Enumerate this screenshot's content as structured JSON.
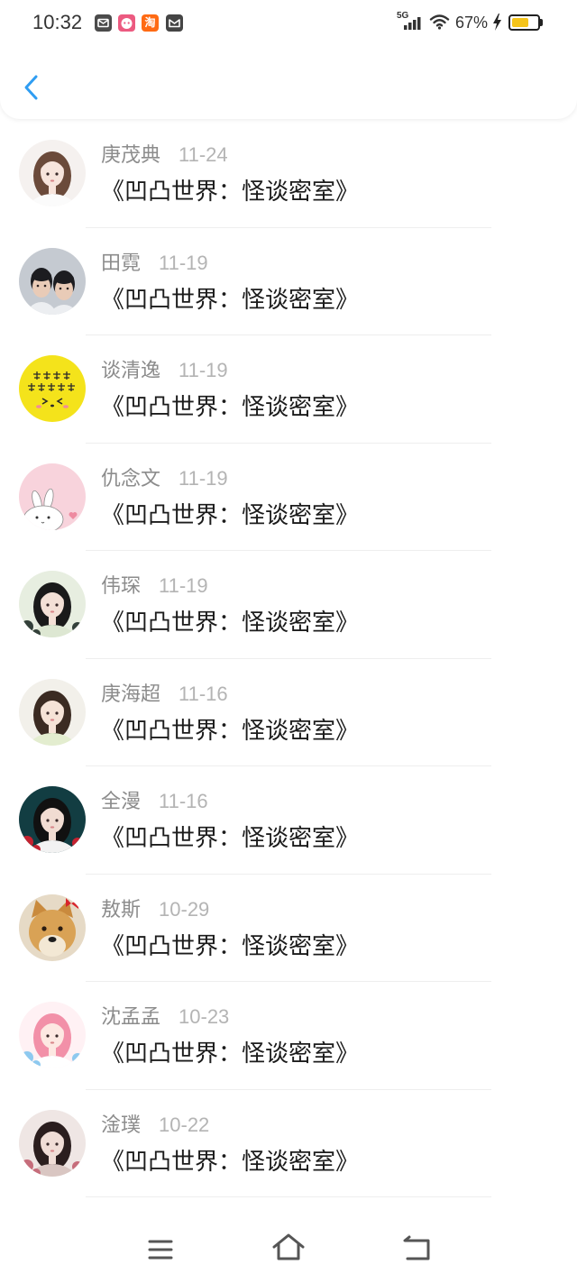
{
  "status_bar": {
    "time": "10:32",
    "apps": [
      {
        "icon": "mail-app-icon",
        "color": "#4b4b4b"
      },
      {
        "icon": "chat-app-icon",
        "color": "#ec5a80"
      },
      {
        "icon": "taobao-app-icon",
        "color": "#ff6a13",
        "label": "淘"
      },
      {
        "icon": "message-app-icon",
        "color": "#454545"
      }
    ],
    "network": "5G",
    "battery_text": "67%",
    "battery_level": 0.67,
    "battery_color": "#f5c41a",
    "charging": true
  },
  "header": {
    "back_icon": "chevron-left-icon",
    "accent_color": "#2f9df2"
  },
  "items": [
    {
      "name": "庚茂典",
      "date": "11-24",
      "title": "《凹凸世界：怪谈密室》",
      "avatar": {
        "icon": "portrait-avatar",
        "bg": "#f5f1ef",
        "hair": "#6b4a3a",
        "skin": "#f7e4dc",
        "cloth": "#fbfbfb"
      }
    },
    {
      "name": "田霓",
      "date": "11-19",
      "title": "《凹凸世界：怪谈密室》",
      "avatar": {
        "icon": "pair-avatar",
        "bg": "#c5cad1",
        "hair": "#1c1c20",
        "skin": "#e9cbb7",
        "cloth": "#eceef1"
      }
    },
    {
      "name": "谈清逸",
      "date": "11-19",
      "title": "《凹凸世界：怪谈密室》",
      "avatar": {
        "icon": "text-face-avatar",
        "bg": "#f4e31b",
        "fg": "#2a2a2a",
        "accent": "#f28a9a"
      }
    },
    {
      "name": "仇念文",
      "date": "11-19",
      "title": "《凹凸世界：怪谈密室》",
      "avatar": {
        "icon": "rabbit-avatar",
        "bg": "#f8d3dc",
        "fg": "#ffffff",
        "accent": "#ee8aa0"
      }
    },
    {
      "name": "伟琛",
      "date": "11-19",
      "title": "《凹凸世界：怪谈密室》",
      "avatar": {
        "icon": "portrait-avatar",
        "bg": "#e7eee0",
        "hair": "#1a1a1a",
        "skin": "#f3e0d6",
        "cloth": "#dde7d2",
        "accent": "#33403a"
      }
    },
    {
      "name": "庚海超",
      "date": "11-16",
      "title": "《凹凸世界：怪谈密室》",
      "avatar": {
        "icon": "portrait-avatar",
        "bg": "#f2f0ea",
        "hair": "#3b2b22",
        "skin": "#f5e3d7",
        "cloth": "#e3edcf"
      }
    },
    {
      "name": "全漫",
      "date": "11-16",
      "title": "《凹凸世界：怪谈密室》",
      "avatar": {
        "icon": "portrait-avatar",
        "bg": "#123d42",
        "hair": "#111111",
        "skin": "#f1dcd2",
        "cloth": "#f2f2f2",
        "accent": "#c42230"
      }
    },
    {
      "name": "敖斯",
      "date": "10-29",
      "title": "《凹凸世界：怪谈密室》",
      "avatar": {
        "icon": "dog-avatar",
        "bg": "#e6dac6",
        "fg": "#d9a255",
        "accent": "#d8252c"
      }
    },
    {
      "name": "沈孟孟",
      "date": "10-23",
      "title": "《凹凸世界：怪谈密室》",
      "avatar": {
        "icon": "portrait-avatar",
        "bg": "#fff1f4",
        "hair": "#f290a8",
        "skin": "#fde8e2",
        "cloth": "#ffffff",
        "accent": "#8ec9ef"
      }
    },
    {
      "name": "淦璞",
      "date": "10-22",
      "title": "《凹凸世界：怪谈密室》",
      "avatar": {
        "icon": "portrait-avatar",
        "bg": "#efe6e4",
        "hair": "#2b1e1e",
        "skin": "#f0ddd6",
        "cloth": "#d9c6c2",
        "accent": "#c66d7b"
      }
    }
  ],
  "nav_bar": {
    "icons": [
      "menu-icon",
      "home-icon",
      "back-icon"
    ],
    "color": "#555555"
  }
}
